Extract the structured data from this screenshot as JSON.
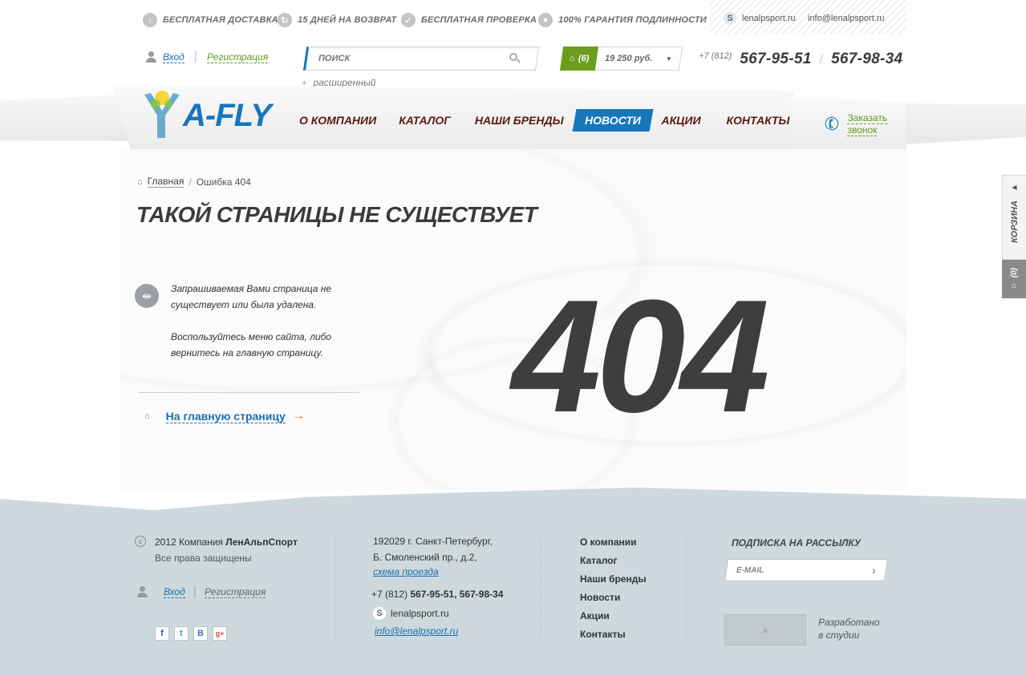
{
  "top_bar": {
    "benefits": [
      {
        "label": "БЕСПЛАТНАЯ ДОСТАВКА",
        "icon": "arrow-down-icon"
      },
      {
        "label": "15 ДНЕЙ НА ВОЗВРАТ",
        "icon": "return-arrow-icon"
      },
      {
        "label": "БЕСПЛАТНАЯ ПРОВЕРКА",
        "icon": "checkmark-icon"
      },
      {
        "label": "100% ГАРАНТИЯ ПОДЛИННОСТИ",
        "icon": "thumbs-up-icon"
      }
    ],
    "skype": "lenalpsport.ru",
    "email": "info@lenalpsport.ru"
  },
  "header": {
    "login": "Вход",
    "register": "Регистрация",
    "search_placeholder": "ПОИСК",
    "advanced_search": "расширенный",
    "cart_count": "(6)",
    "cart_sum": "19 250 руб.",
    "phone_prefix": "+7 (812)",
    "phone_1": "567-95-51",
    "phone_2": "567-98-34"
  },
  "logo": {
    "text": "A-FLY"
  },
  "nav": {
    "items": [
      "О КОМПАНИИ",
      "КАТАЛОГ",
      "НАШИ БРЕНДЫ",
      "НОВОСТИ",
      "АКЦИИ",
      "КОНТАКТЫ"
    ],
    "active": "НОВОСТИ",
    "callback_line1": "Заказать",
    "callback_line2": "звонок"
  },
  "breadcrumb": {
    "home": "Главная",
    "separator": "/",
    "current": "Ошибка 404"
  },
  "page": {
    "title": "ТАКОЙ СТРАНИЦЫ НЕ СУЩЕСТВУЕТ",
    "message_1a": "Запрашиваемая Вами страница не",
    "message_1b": "существует или была удалена.",
    "message_2a": "Воспользуйтесь меню сайта, либо",
    "message_2b": "вернитесь на главную страницу.",
    "home_link": "На главную страницу",
    "arrow": "→",
    "error_code": "404"
  },
  "side_cart": {
    "label": "КОРЗИНА",
    "count": "(0)"
  },
  "footer": {
    "copyright_year": "2012 Компания",
    "company": "ЛенАльпСпорт",
    "rights": "Все права защищены",
    "login": "Вход",
    "register": "Регистрация",
    "address_1": "192029 г. Санкт-Петербург,",
    "address_2": "Б. Смоленский пр., д.2,",
    "map_link": "схема проезда",
    "phone_prefix": "+7 (812)",
    "phones": "567-95-51, 567-98-34",
    "skype": "lenalpsport.ru",
    "email": "info@lenalpsport.ru",
    "menu": [
      "О компании",
      "Каталог",
      "Наши бренды",
      "Новости",
      "Акции",
      "Контакты"
    ],
    "subscribe_title": "ПОДПИСКА НА РАССЫЛКУ",
    "email_placeholder": "E-MAIL",
    "developed_1": "Разработано",
    "developed_2": "в студии",
    "studio_logo_alt": "x"
  },
  "colors": {
    "accent_blue": "#1677bd",
    "accent_green": "#6b9e1c",
    "footer_bg": "#cdd9dc",
    "nav_text": "#5a1a0e"
  }
}
